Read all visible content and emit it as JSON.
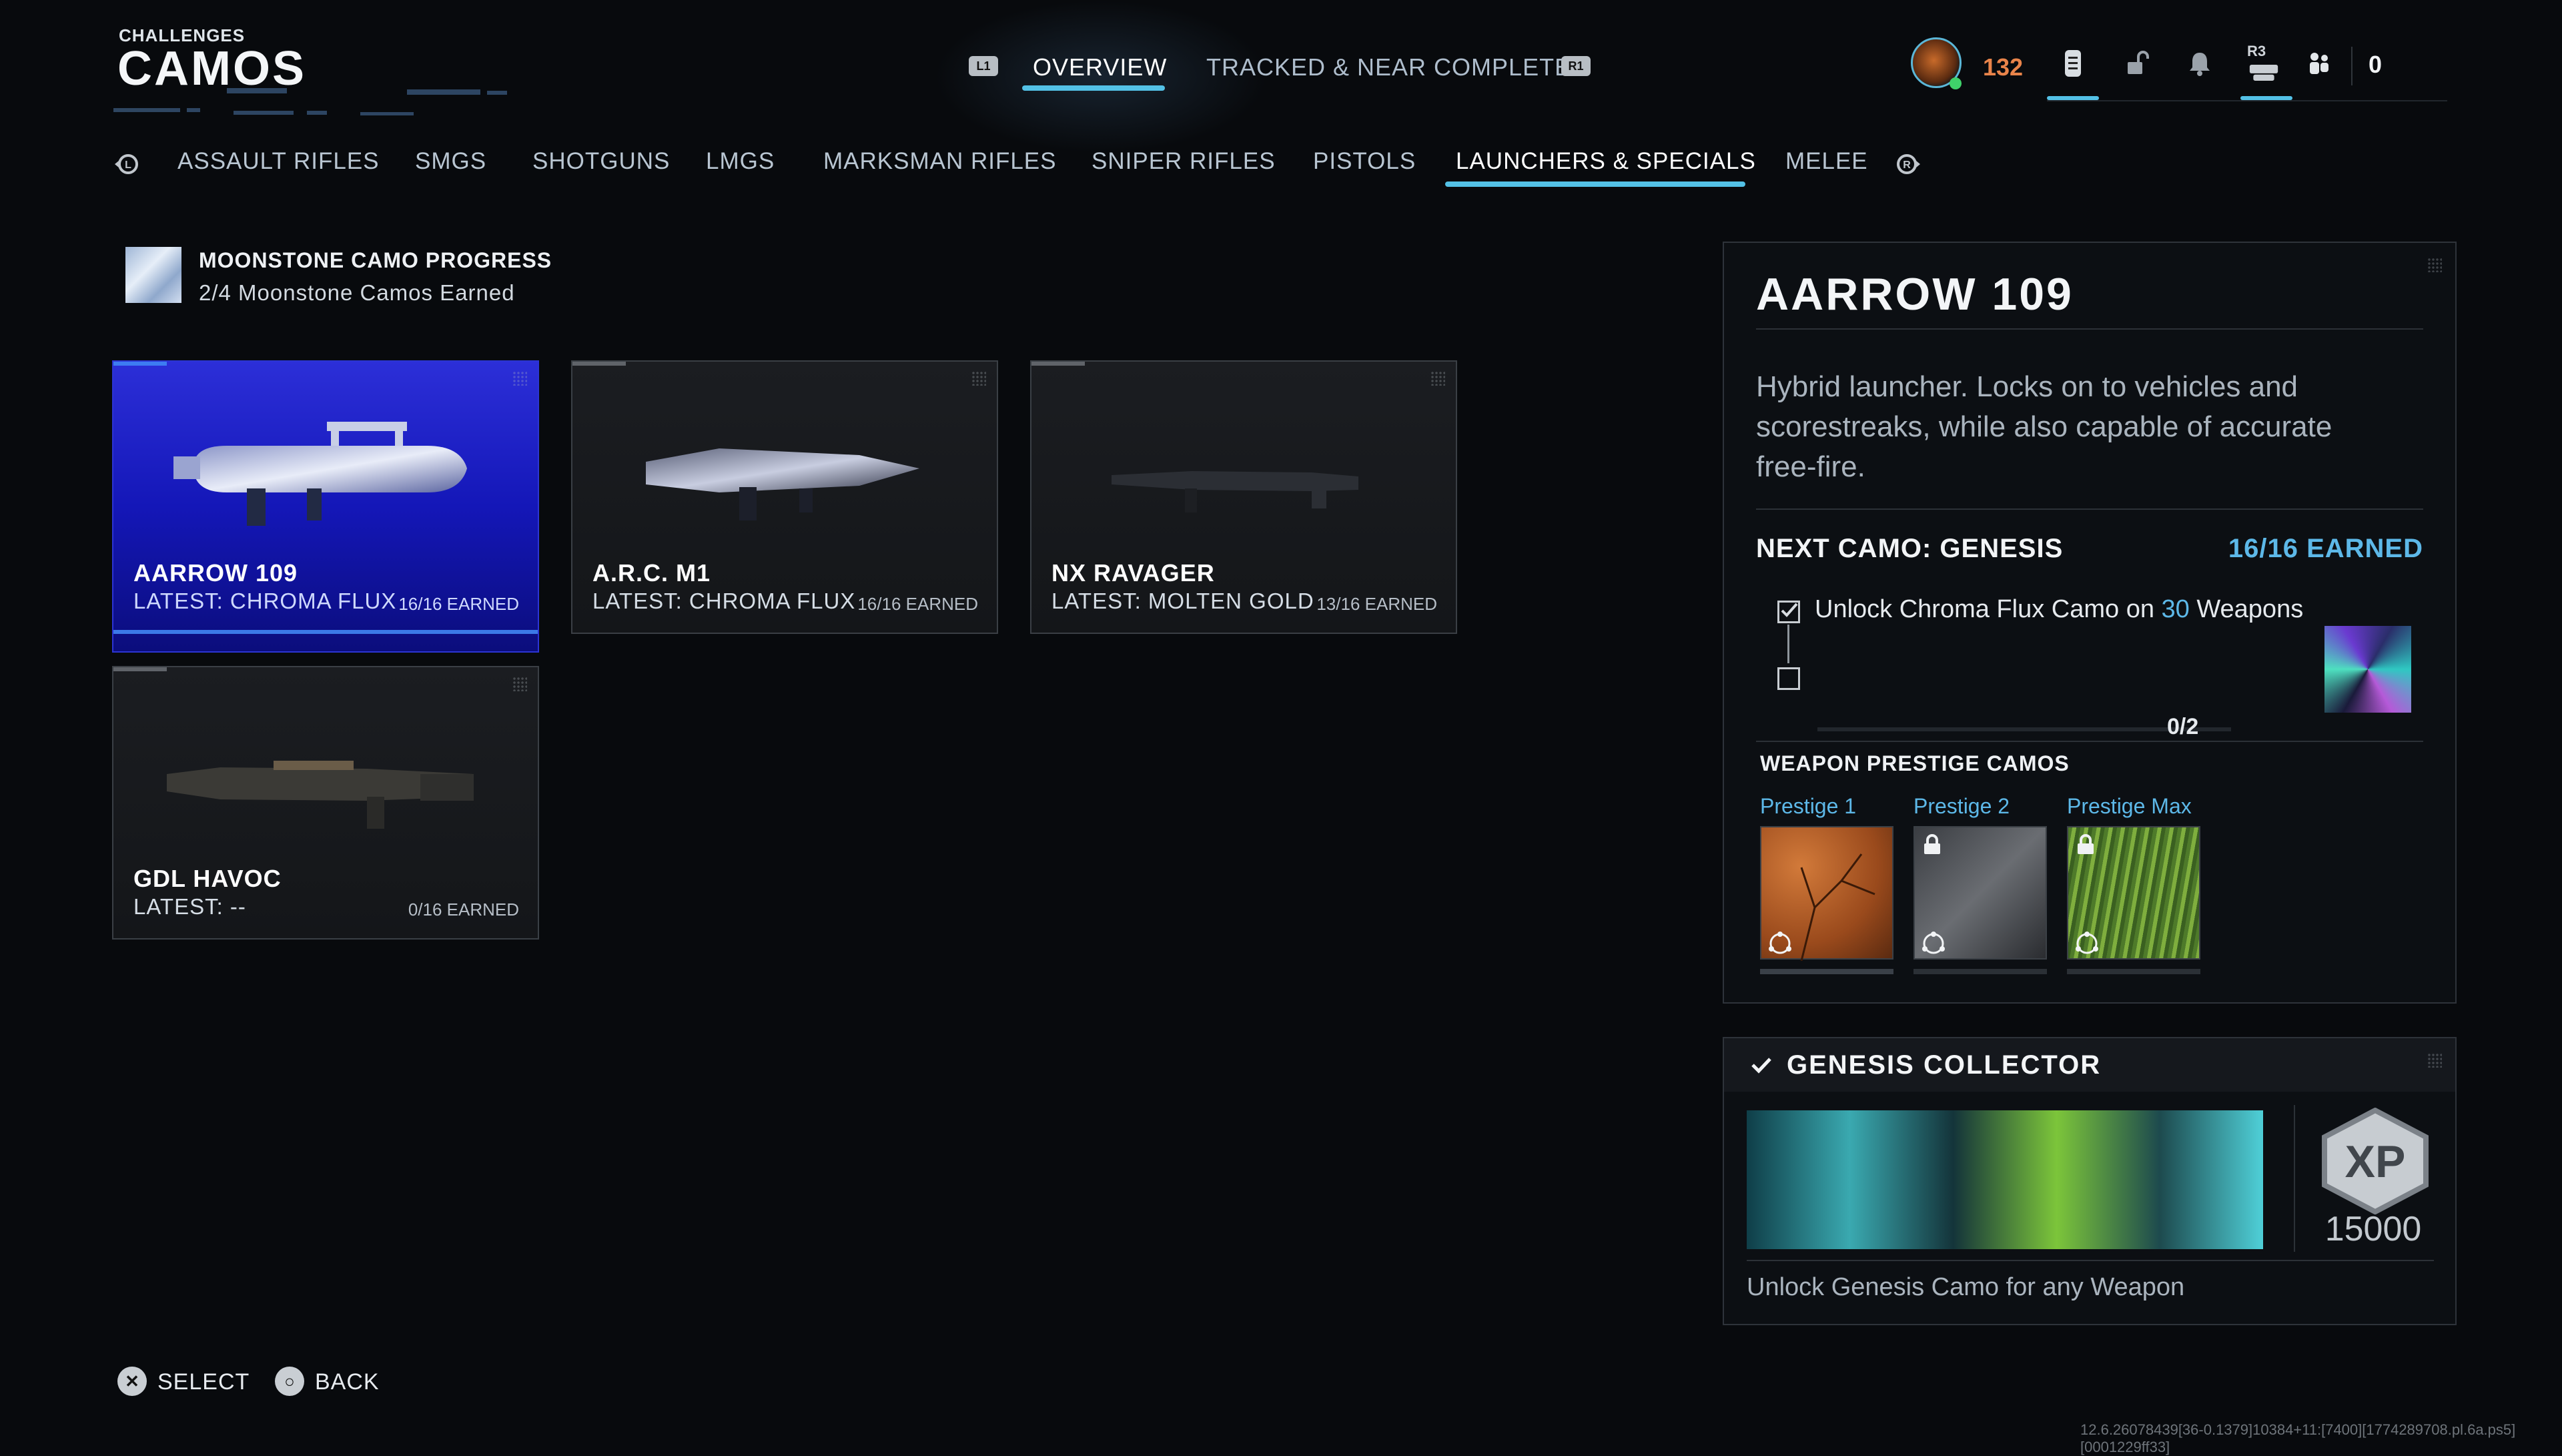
{
  "header": {
    "subtitle": "CHALLENGES",
    "title": "CAMOS",
    "left_bumper": "L1",
    "right_bumper": "R1",
    "tabs": [
      {
        "label": "OVERVIEW",
        "active": true
      },
      {
        "label": "TRACKED & NEAR COMPLETE",
        "active": false
      }
    ],
    "player_level": "132",
    "r3_label": "R3",
    "count": "0"
  },
  "categories": {
    "items": [
      {
        "label": "ASSAULT RIFLES",
        "active": false
      },
      {
        "label": "SMGS",
        "active": false
      },
      {
        "label": "SHOTGUNS",
        "active": false
      },
      {
        "label": "LMGS",
        "active": false
      },
      {
        "label": "MARKSMAN RIFLES",
        "active": false
      },
      {
        "label": "SNIPER RIFLES",
        "active": false
      },
      {
        "label": "PISTOLS",
        "active": false
      },
      {
        "label": "LAUNCHERS & SPECIALS",
        "active": true
      },
      {
        "label": "MELEE",
        "active": false
      }
    ]
  },
  "moonstone": {
    "title": "MOONSTONE CAMO PROGRESS",
    "progress": "2/4 Moonstone Camos Earned"
  },
  "weapons": [
    {
      "name": "AARROW 109",
      "latest": "LATEST: CHROMA FLUX",
      "earned": "16/16 EARNED",
      "selected": true
    },
    {
      "name": "A.R.C. M1",
      "latest": "LATEST: CHROMA FLUX",
      "earned": "16/16 EARNED",
      "selected": false
    },
    {
      "name": "NX RAVAGER",
      "latest": "LATEST: MOLTEN GOLD",
      "earned": "13/16 EARNED",
      "selected": false
    },
    {
      "name": "GDL HAVOC",
      "latest": "LATEST: --",
      "earned": "0/16 EARNED",
      "selected": false
    }
  ],
  "detail": {
    "title": "AARROW 109",
    "description": "Hybrid launcher. Locks on to vehicles and scorestreaks, while also capable of accurate free-fire.",
    "next_camo": "NEXT CAMO: GENESIS",
    "earned": "16/16 EARNED",
    "task_prefix": "Unlock Chroma Flux Camo on ",
    "task_highlight": "30",
    "task_suffix": " Weapons",
    "task_progress": "0/2",
    "task_progress_value": 0,
    "prestige_header": "WEAPON PRESTIGE CAMOS",
    "prestige": [
      {
        "label": "Prestige 1",
        "locked": false
      },
      {
        "label": "Prestige 2",
        "locked": true
      },
      {
        "label": "Prestige Max",
        "locked": true
      }
    ]
  },
  "collector": {
    "title": "GENESIS COLLECTOR",
    "xp_badge": "XP",
    "xp_value": "15000",
    "description": "Unlock Genesis Camo for any Weapon"
  },
  "footer": {
    "select_label": "SELECT",
    "back_label": "BACK",
    "build_info": "12.6.26078439[36-0.1379]10384+11:[7400][1774289708.pl.6a.ps5][0001229ff33]"
  },
  "colors": {
    "accent": "#53c1e6",
    "selected_card": "#1f22c8",
    "level": "#e9844a",
    "highlight": "#5db8e8"
  }
}
